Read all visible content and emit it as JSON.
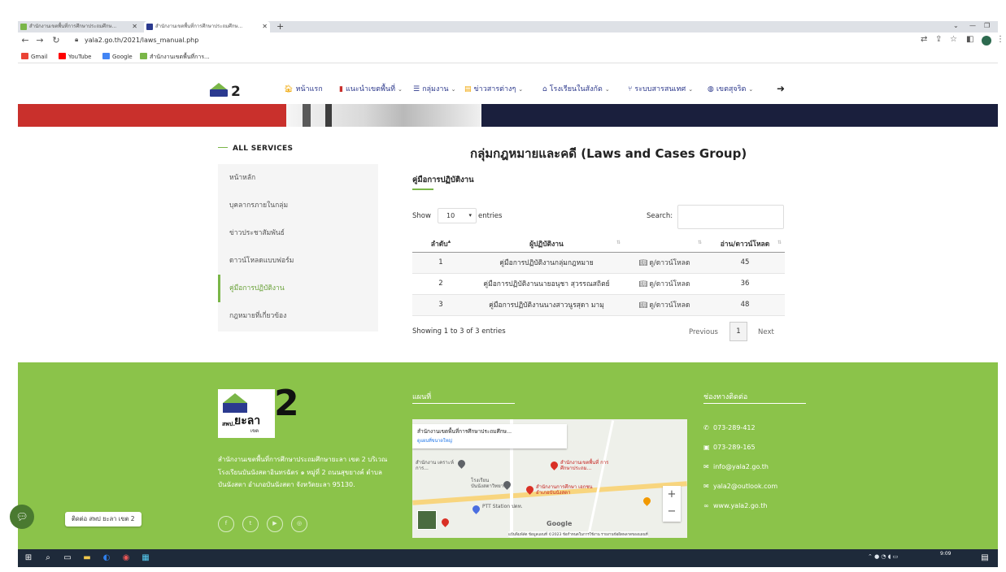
{
  "browser": {
    "tabs": [
      {
        "title": "สำนักงานเขตพื้นที่การศึกษาประถมศึกษ...",
        "active": false
      },
      {
        "title": "สำนักงานเขตพื้นที่การศึกษาประถมศึกษ...",
        "active": true
      }
    ],
    "new_tab": "+",
    "url": "yala2.go.th/2021/laws_manual.php",
    "bookmarks": [
      "Gmail",
      "YouTube",
      "Google",
      "สำนักงานเขตพื้นที่การ..."
    ]
  },
  "site": {
    "logo_number": "2",
    "nav": [
      {
        "icon": "home-icon",
        "label": "หน้าแรก",
        "dropdown": false
      },
      {
        "icon": "book-icon",
        "label": "แนะนำเขตพื้นที่",
        "dropdown": true
      },
      {
        "icon": "list-icon",
        "label": "กลุ่มงาน",
        "dropdown": true
      },
      {
        "icon": "news-icon",
        "label": "ข่าวสารต่างๆ",
        "dropdown": true
      },
      {
        "icon": "school-icon",
        "label": "โรงเรียนในสังกัด",
        "dropdown": true
      },
      {
        "icon": "network-icon",
        "label": "ระบบสารสนเทศ",
        "dropdown": true
      },
      {
        "icon": "globe-icon",
        "label": "เขตสุจริต",
        "dropdown": true
      }
    ],
    "sidebar": {
      "heading": "ALL SERVICES",
      "items": [
        {
          "label": "หน้าหลัก",
          "active": false
        },
        {
          "label": "บุคลากรภายในกลุ่ม",
          "active": false
        },
        {
          "label": "ข่าวประชาสัมพันธ์",
          "active": false
        },
        {
          "label": "ดาวน์โหลดแบบฟอร์ม",
          "active": false
        },
        {
          "label": "คู่มือการปฏิบัติงาน",
          "active": true
        },
        {
          "label": "กฎหมายที่เกี่ยวข้อง",
          "active": false
        }
      ]
    },
    "main": {
      "title": "กลุ่มกฎหมายและคดี (Laws and Cases Group)",
      "subtitle": "คู่มือการปฏิบัติงาน",
      "show_label": "Show",
      "page_length": "10",
      "entries_label": "entries",
      "search_label": "Search:",
      "search_value": "",
      "table": {
        "columns": [
          "ลำดับ",
          "ผู้ปฏิบัติงาน",
          "",
          "อ่าน/ดาวน์โหลด"
        ],
        "rows": [
          {
            "no": "1",
            "name": "คู่มือการปฏิบัติงานกลุ่มกฎหมาย",
            "link": "ดู/ดาวน์โหลด",
            "count": "45"
          },
          {
            "no": "2",
            "name": "คู่มือการปฏิบัติงานนายอนุชา สุวรรณสถิตย์",
            "link": "ดู/ดาวน์โหลด",
            "count": "36"
          },
          {
            "no": "3",
            "name": "คู่มือการปฏิบัติงานนางสาวนูรสุดา มามุ",
            "link": "ดู/ดาวน์โหลด",
            "count": "48"
          }
        ]
      },
      "info": "Showing 1 to 3 of 3 entries",
      "pagination": {
        "previous": "Previous",
        "current": "1",
        "next": "Next"
      }
    },
    "footer": {
      "logo_text_small": "สพป.",
      "logo_text_name": "ยะลา",
      "logo_text_zone": "เขต",
      "logo_number": "2",
      "address": "สำนักงานเขตพื้นที่การศึกษาประถมศึกษายะลา เขต 2 บริเวณโรงเรียนบันนังสตาอินทรฉัตร ๑ หมู่ที่ 2 ถนนสุขยางค์ ตำบลบันนังสตา อำเภอบันนังสตา จังหวัดยะลา 95130.",
      "social": [
        "facebook-icon",
        "twitter-icon",
        "youtube-icon",
        "instagram-icon"
      ],
      "map_title": "แผนที่",
      "map": {
        "place_name": "สำนักงานเขตพื้นที่การศึกษาประถมศึกษ...",
        "place_link": "ดูแผนที่ขนาดใหญ่",
        "labels": [
          "สำนักงานเขตพื้นที่ การศึกษาประถม...",
          "โรงเรียน บันนังสตาวิทยา",
          "สำนักงานการศึกษา เอกชนอำเภอบันนังสตา",
          "PTT Station ปตท.",
          "สำนักงาน เคราะห์ การ..."
        ],
        "attribution": "แป้นพิมพ์ลัด  ข้อมูลแผนที่ ©2023  ข้อกำหนดในการใช้งาน  รายงานข้อผิดพลาดของแผนที่",
        "google": "Google"
      },
      "contact_title": "ช่องทางติดต่อ",
      "contacts": [
        {
          "icon": "phone-icon",
          "text": "073-289-412"
        },
        {
          "icon": "fax-icon",
          "text": "073-289-165"
        },
        {
          "icon": "mail-icon",
          "text": "info@yala2.go.th"
        },
        {
          "icon": "mail-icon",
          "text": "yala2@outlook.com"
        },
        {
          "icon": "link-icon",
          "text": "www.yala2.go.th"
        }
      ]
    },
    "chat": {
      "label": "ติดต่อ สพป ยะลา เขต 2"
    }
  },
  "taskbar": {
    "time": "9:09"
  }
}
